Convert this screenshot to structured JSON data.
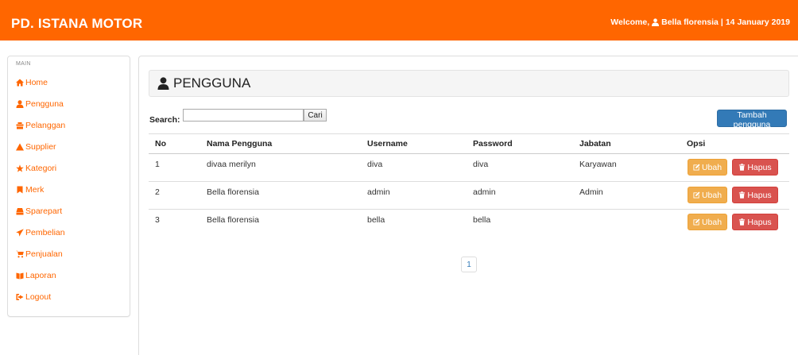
{
  "header": {
    "brand": "PD. ISTANA MOTOR",
    "welcome_prefix": "Welcome,",
    "welcome_user": "Bella florensia",
    "welcome_sep": "|",
    "welcome_date": "14 January 2019"
  },
  "sidebar": {
    "heading": "MAIN",
    "items": [
      {
        "label": "Home",
        "icon": "home-icon"
      },
      {
        "label": "Pengguna",
        "icon": "user-icon"
      },
      {
        "label": "Pelanggan",
        "icon": "tower-icon"
      },
      {
        "label": "Supplier",
        "icon": "tent-icon"
      },
      {
        "label": "Kategori",
        "icon": "star-icon"
      },
      {
        "label": "Merk",
        "icon": "bookmark-icon"
      },
      {
        "label": "Sparepart",
        "icon": "hdd-icon"
      },
      {
        "label": "Pembelian",
        "icon": "plane-icon"
      },
      {
        "label": "Penjualan",
        "icon": "cart-icon"
      },
      {
        "label": "Laporan",
        "icon": "book-icon"
      },
      {
        "label": "Logout",
        "icon": "logout-icon"
      }
    ]
  },
  "main": {
    "title": "PENGGUNA",
    "search_label": "Search:",
    "search_value": "",
    "search_button": "Cari",
    "add_button": "Tambah pengguna",
    "columns": [
      "No",
      "Nama Pengguna",
      "Username",
      "Password",
      "Jabatan",
      "Opsi"
    ],
    "rows": [
      {
        "no": "1",
        "nama": "divaa merilyn",
        "username": "diva",
        "password": "diva",
        "jabatan": "Karyawan"
      },
      {
        "no": "2",
        "nama": "Bella florensia",
        "username": "admin",
        "password": "admin",
        "jabatan": "Admin"
      },
      {
        "no": "3",
        "nama": "Bella florensia",
        "username": "bella",
        "password": "bella",
        "jabatan": ""
      }
    ],
    "edit_label": "Ubah",
    "delete_label": "Hapus",
    "pagination": [
      "1"
    ]
  },
  "colors": {
    "brand": "#ff6600",
    "primary": "#337ab7",
    "warning": "#f0ad4e",
    "danger": "#d9534f"
  }
}
